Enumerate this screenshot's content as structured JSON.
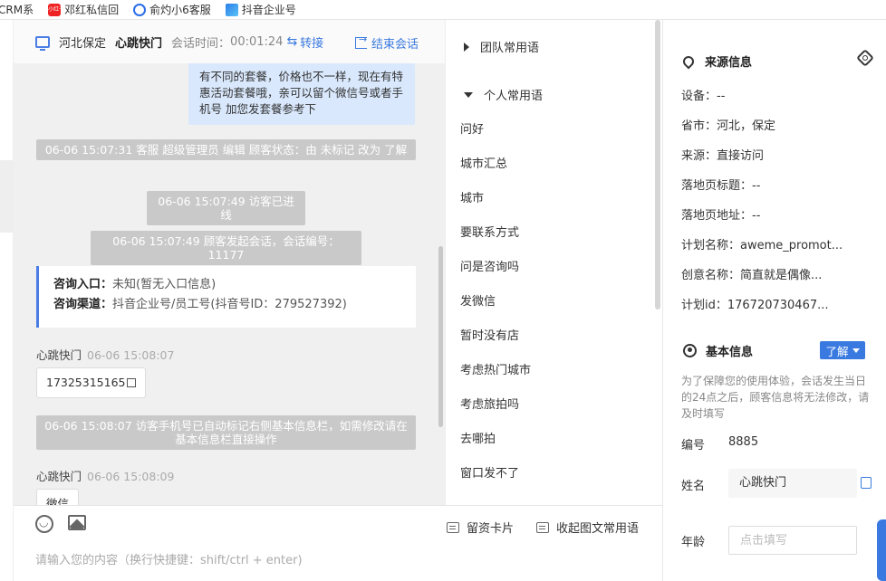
{
  "bookmarks": [
    {
      "label": "CRM系"
    },
    {
      "label": "邓红私信回"
    },
    {
      "label": "俞灼小6客服"
    },
    {
      "label": "抖音企业号"
    }
  ],
  "bookmark_icon_text": "小红书",
  "header": {
    "location": "河北保定",
    "visitor_name": "心跳快门",
    "session_time_label": "会话时间：",
    "session_time": "00:01:24",
    "transfer_label": "转接",
    "end_label": "结束会话"
  },
  "messages": {
    "self_bubble": "有不同的套餐，价格也不一样，现在有特惠活动套餐哦，亲可以留个微信号或者手机号 加您发套餐参考下",
    "sys1": "06-06 15:07:31 客服 超级管理员 编辑 顾客状态：由 未标记 改为 了解",
    "sys2": "06-06 15:07:49 访客已进线",
    "sys3": "06-06 15:07:49 顾客发起会话，会话编号：11177",
    "card": {
      "entry_label": "咨询入口：",
      "entry_value": "未知(暂无入口信息)",
      "channel_label": "咨询渠道：",
      "channel_value": "抖音企业号/员工号(抖音号ID：279527392)"
    },
    "sender1": {
      "name": "心跳快门",
      "time": "06-06 15:08:07"
    },
    "phone_msg": "17325315165",
    "sys4": "06-06 15:08:07 访客手机号已自动标记右侧基本信息栏，如需修改请在基本信息栏直接操作",
    "sender2": {
      "name": "心跳快门",
      "time": "06-06 15:08:09"
    },
    "partial_msg": "微信"
  },
  "input": {
    "placeholder": "请输入您的内容（换行快捷键：shift/ctrl + enter)",
    "tool_card": "留资卡片",
    "tool_phrases": "收起图文常用语"
  },
  "phrases": {
    "team_group": "团队常用语",
    "personal_group": "个人常用语",
    "items": [
      "问好",
      "城市汇总",
      "城市",
      "要联系方式",
      "问是咨询吗",
      "发微信",
      "暂时没有店",
      "考虑热门城市",
      "考虑旅拍吗",
      "去哪拍",
      "窗口发不了"
    ]
  },
  "info": {
    "source_title": "来源信息",
    "rows": [
      "设备：--",
      "省市：河北，保定",
      "来源：直接访问",
      "落地页标题：--",
      "落地页地址：--",
      "计划名称：aweme_promot...",
      "创意名称：简直就是偶像...",
      "计划id：176720730467..."
    ],
    "basic_title": "基本信息",
    "status_badge": "了解",
    "hint": "为了保障您的使用体验，会话发生当日的24点之后，顾客信息将无法修改，请及时填写",
    "number_label": "编号",
    "number_value": "8885",
    "name_label": "姓名",
    "name_value": "心跳快门",
    "age_label": "年龄",
    "age_placeholder": "点击填写"
  }
}
